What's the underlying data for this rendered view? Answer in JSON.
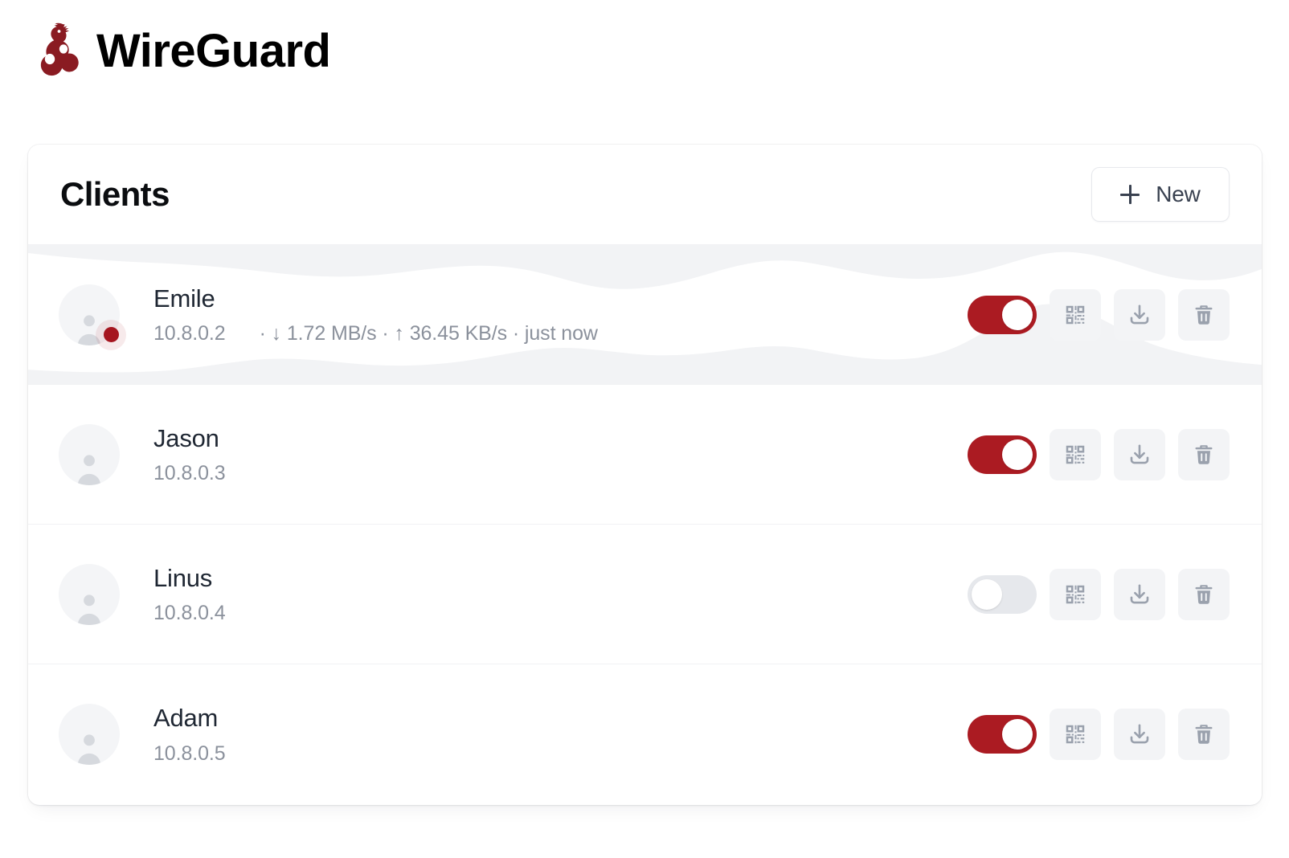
{
  "app": {
    "name": "WireGuard",
    "logo_icon": "wireguard-dragon-logo",
    "brand_color": "#8a1b22"
  },
  "card": {
    "title": "Clients",
    "new_button": {
      "label": "New",
      "icon": "plus-icon"
    }
  },
  "icons": {
    "qr": "qr-code-icon",
    "download": "download-icon",
    "delete": "trash-icon",
    "avatar": "user-avatar-icon",
    "status": "status-dot-icon",
    "down_arrow": "↓",
    "up_arrow": "↑",
    "separator": "·"
  },
  "colors": {
    "toggle_on": "#ab1b22",
    "toggle_off": "#e6e8ec",
    "status_online": "#a5151f",
    "icon_gray": "#9aa1ad",
    "card_bg": "#ffffff",
    "page_bg": "#ffffff"
  },
  "clients": [
    {
      "name": "Emile",
      "ip": "10.8.0.2",
      "enabled": true,
      "online": true,
      "transfer_text": "· ↓ 1.72 MB/s · ↑ 36.45 KB/s · just now",
      "download_rate": "1.72 MB/s",
      "upload_rate": "36.45 KB/s",
      "last_seen": "just now",
      "has_traffic_chart": true
    },
    {
      "name": "Jason",
      "ip": "10.8.0.3",
      "enabled": true,
      "online": false,
      "transfer_text": "",
      "download_rate": "",
      "upload_rate": "",
      "last_seen": "",
      "has_traffic_chart": false
    },
    {
      "name": "Linus",
      "ip": "10.8.0.4",
      "enabled": false,
      "online": false,
      "transfer_text": "",
      "download_rate": "",
      "upload_rate": "",
      "last_seen": "",
      "has_traffic_chart": false
    },
    {
      "name": "Adam",
      "ip": "10.8.0.5",
      "enabled": true,
      "online": false,
      "transfer_text": "",
      "download_rate": "",
      "upload_rate": "",
      "last_seen": "",
      "has_traffic_chart": false
    }
  ],
  "chart_data": {
    "type": "area",
    "title": "Emile traffic sparkline",
    "series": [
      {
        "name": "download",
        "direction": "top-down",
        "values": [
          0,
          0,
          0,
          2,
          14,
          20,
          16,
          8,
          10,
          18,
          22,
          18,
          6,
          2,
          12,
          22,
          18,
          4,
          0
        ]
      },
      {
        "name": "upload",
        "direction": "bottom-up",
        "values": [
          0,
          6,
          16,
          18,
          12,
          4,
          2,
          10,
          20,
          22,
          20,
          10,
          4,
          14,
          30,
          26,
          8,
          4,
          2
        ]
      }
    ],
    "grid": false,
    "legend": "none",
    "fill_color": "#f2f3f5"
  }
}
